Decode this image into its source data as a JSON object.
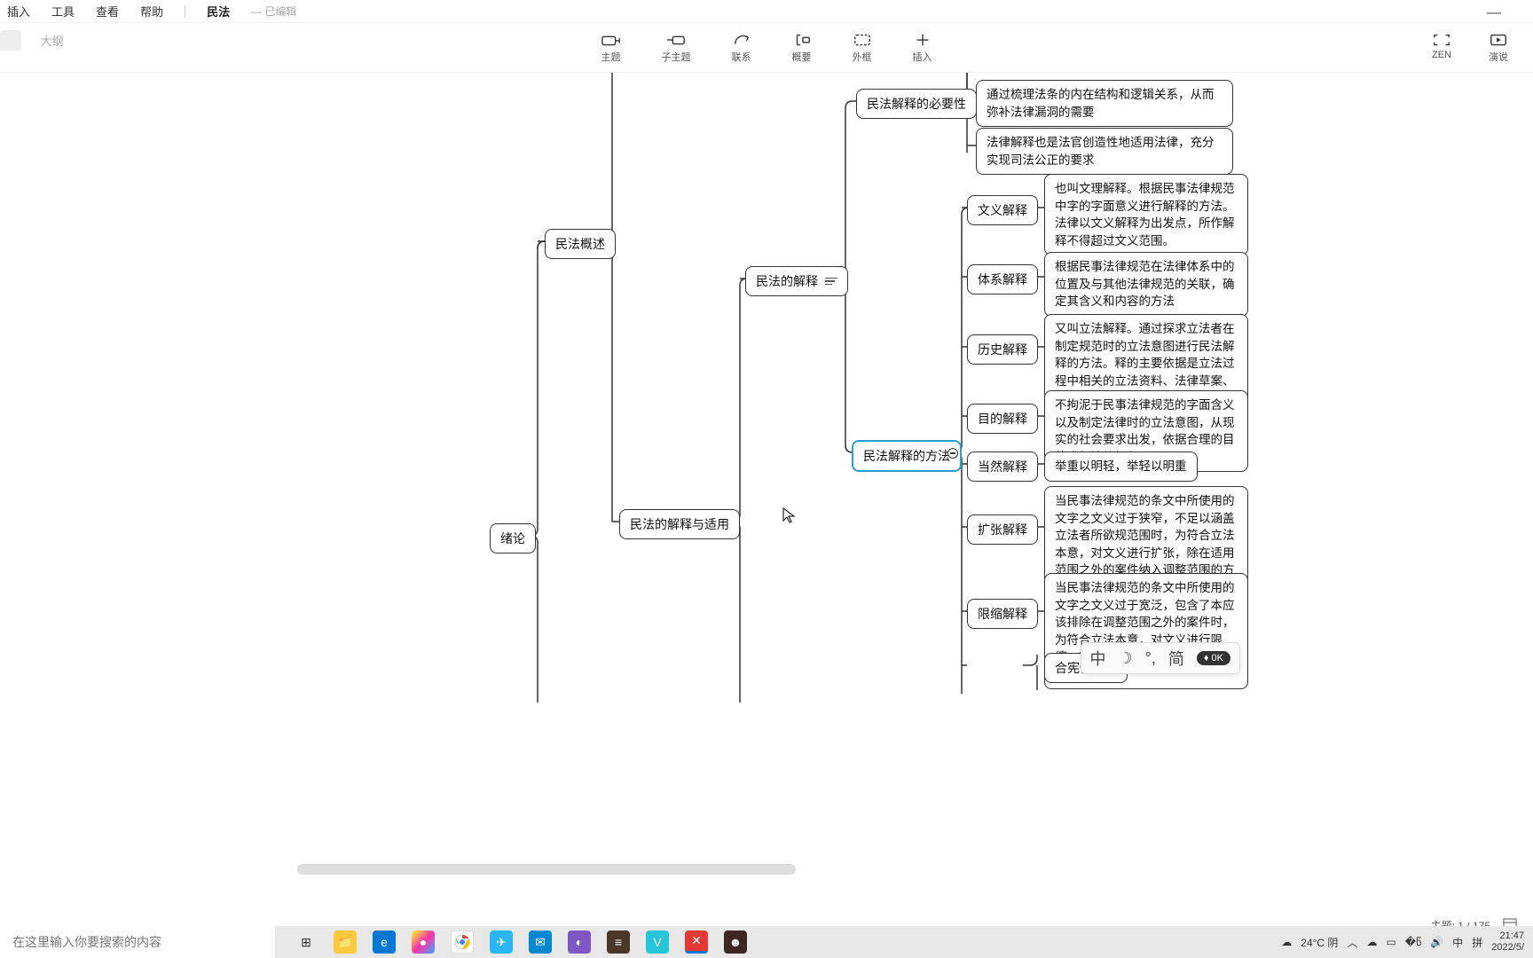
{
  "menu": {
    "items": [
      "插入",
      "工具",
      "查看",
      "帮助"
    ],
    "doc_title": "民法",
    "doc_status": "— 已编辑"
  },
  "tabs": {
    "edge_label": "",
    "outline": "大纲"
  },
  "toolbar": {
    "main": [
      {
        "l": "主题"
      },
      {
        "l": "子主题"
      },
      {
        "l": "联系"
      },
      {
        "l": "概要"
      },
      {
        "l": "外框"
      },
      {
        "l": "插入"
      }
    ],
    "right": [
      {
        "l": "ZEN"
      },
      {
        "l": "演说"
      }
    ]
  },
  "mindmap": {
    "n1": "绪论",
    "n2": "民法概述",
    "n3": "民法的解释与适用",
    "n4": "民法的解释",
    "n5": "民法解释的必要性",
    "n5a": "通过梳理法条的内在结构和逻辑关系，从而弥补法律漏洞的需要",
    "n5b": "法律解释也是法官创造性地适用法律，充分实现司法公正的要求",
    "n6": "民法解释的方法",
    "m": {
      "wy": {
        "t": "文义解释",
        "d": "也叫文理解释。根据民事法律规范中字的字面意义进行解释的方法。法律以文义解释为出发点，所作解释不得超过文义范围。"
      },
      "tx": {
        "t": "体系解释",
        "d": "根据民事法律规范在法律体系中的位置及与其他法律规范的关联，确定其含义和内容的方法"
      },
      "ls": {
        "t": "历史解释",
        "d": "又叫立法解释。通过探求立法者在制定规范时的立法意图进行民法解释的方法。释的主要依据是立法过程中相关的立法资料、法律草案、立法理由书等。"
      },
      "md": {
        "t": "目的解释",
        "d": "不拘泥于民事法律规范的字面含义以及制定法律时的立法意图，从现实的社会要求出发，依据合理的目的进行法律解释"
      },
      "dr": {
        "t": "当然解释",
        "d": "举重以明轻，举轻以明重"
      },
      "kz": {
        "t": "扩张解释",
        "d": "当民事法律规范的条文中所使用的文字之文义过于狭窄，不足以涵盖立法者所欲规范围时，为符合立法本意，对文义进行扩张，除在适用范围之外的案件纳入调整范围的方法。"
      },
      "xs": {
        "t": "限缩解释",
        "d": "当民事法律规范的条文中所使用的文字之文义过于宽泛，包含了本应该排除在调整范围之外的案件时，为符合立法本意，对文义进行限缩，将不应适用该条文的案件排除在外的解释。"
      },
      "hx": {
        "t": "合宪性解释"
      }
    }
  },
  "status": {
    "topic": "主题: 1 / 175"
  },
  "ime": {
    "mode": "中",
    "style": "简",
    "badge": "0K"
  },
  "taskbar": {
    "search_placeholder": "在这里输入你要搜索的内容",
    "weather": "24°C 阴",
    "lang1": "中",
    "lang2": "拼",
    "time": "21:47",
    "date": "2022/5/"
  }
}
